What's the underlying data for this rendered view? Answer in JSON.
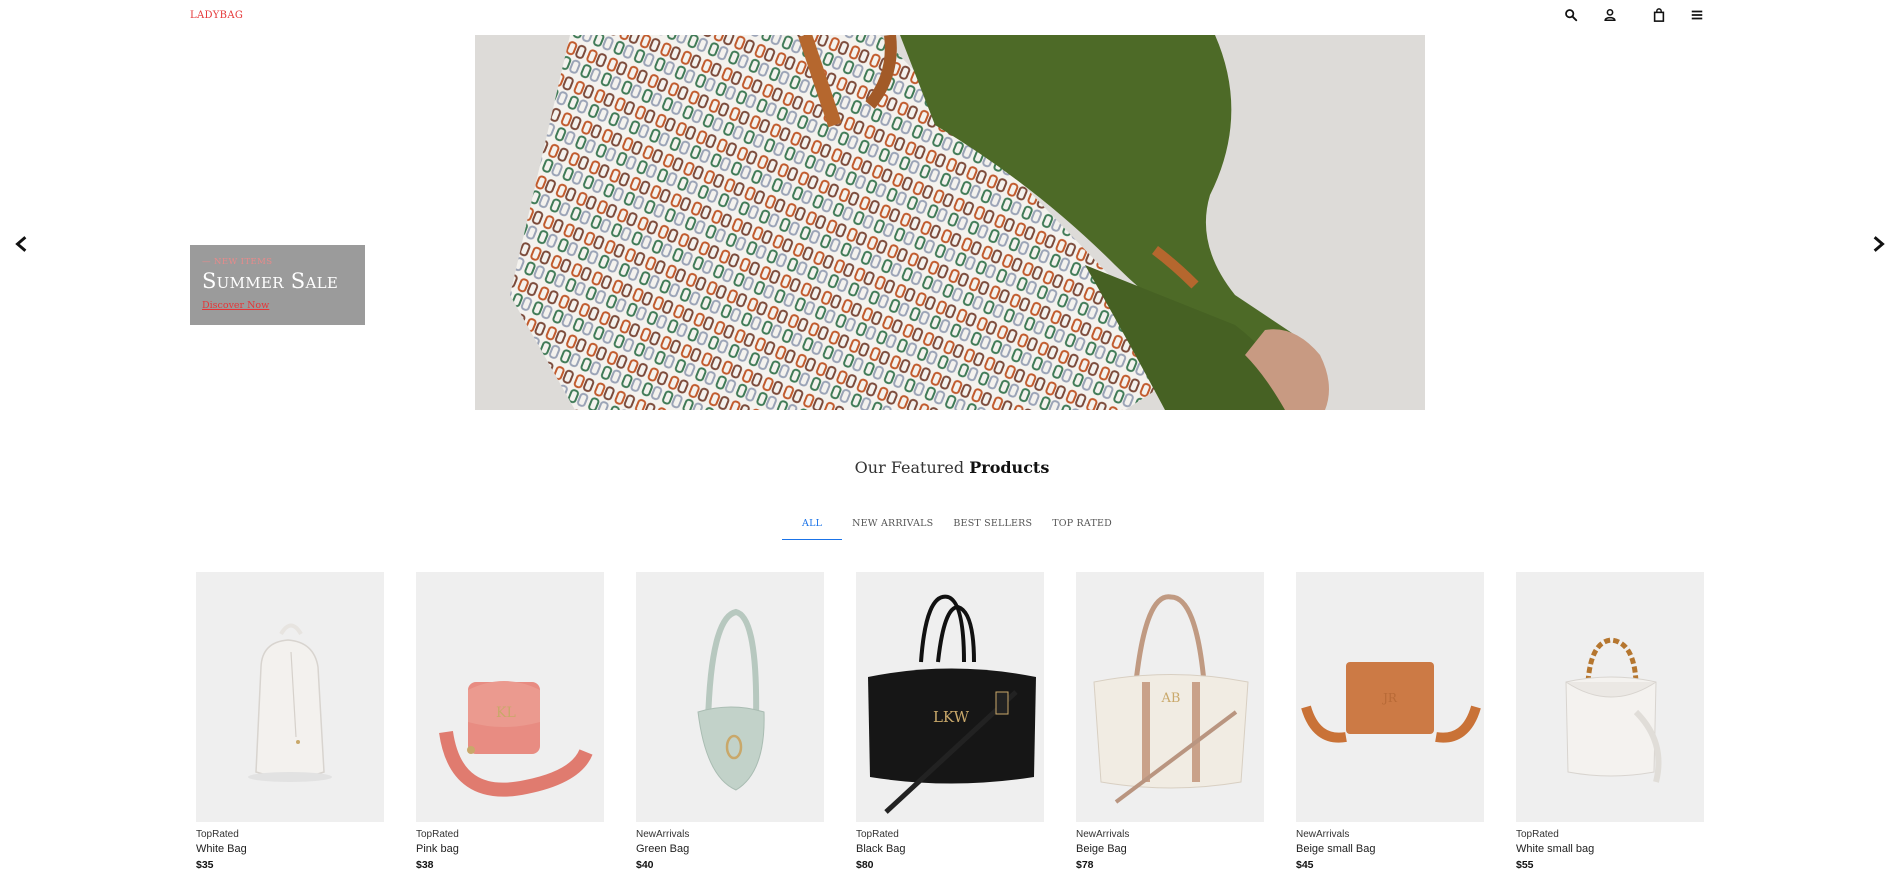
{
  "header": {
    "logo": "LADYBAG",
    "icons": [
      "search-icon",
      "user-icon",
      "bag-icon",
      "menu-icon"
    ]
  },
  "hero": {
    "kicker": "— NEW ITEMS",
    "title": "Summer Sale",
    "link": "Discover Now"
  },
  "featured": {
    "title_light": "Our Featured",
    "title_bold": "Products"
  },
  "tabs": [
    "ALL",
    "NEW ARRIVALS",
    "BEST SELLERS",
    "TOP RATED"
  ],
  "active_tab": "ALL",
  "products": [
    {
      "category": "TopRated",
      "name": "White Bag",
      "price": "$35"
    },
    {
      "category": "TopRated",
      "name": "Pink bag",
      "price": "$38"
    },
    {
      "category": "NewArrivals",
      "name": "Green Bag",
      "price": "$40"
    },
    {
      "category": "TopRated",
      "name": "Black Bag",
      "price": "$80"
    },
    {
      "category": "NewArrivals",
      "name": "Beige Bag",
      "price": "$78"
    },
    {
      "category": "NewArrivals",
      "name": "Beige small Bag",
      "price": "$45"
    },
    {
      "category": "TopRated",
      "name": "White small bag",
      "price": "$55"
    }
  ],
  "colors": {
    "accent": "#e53637",
    "tab_active": "#1a73e8",
    "promo_bg": "#9b9b9b",
    "card_bg": "#efefef"
  }
}
